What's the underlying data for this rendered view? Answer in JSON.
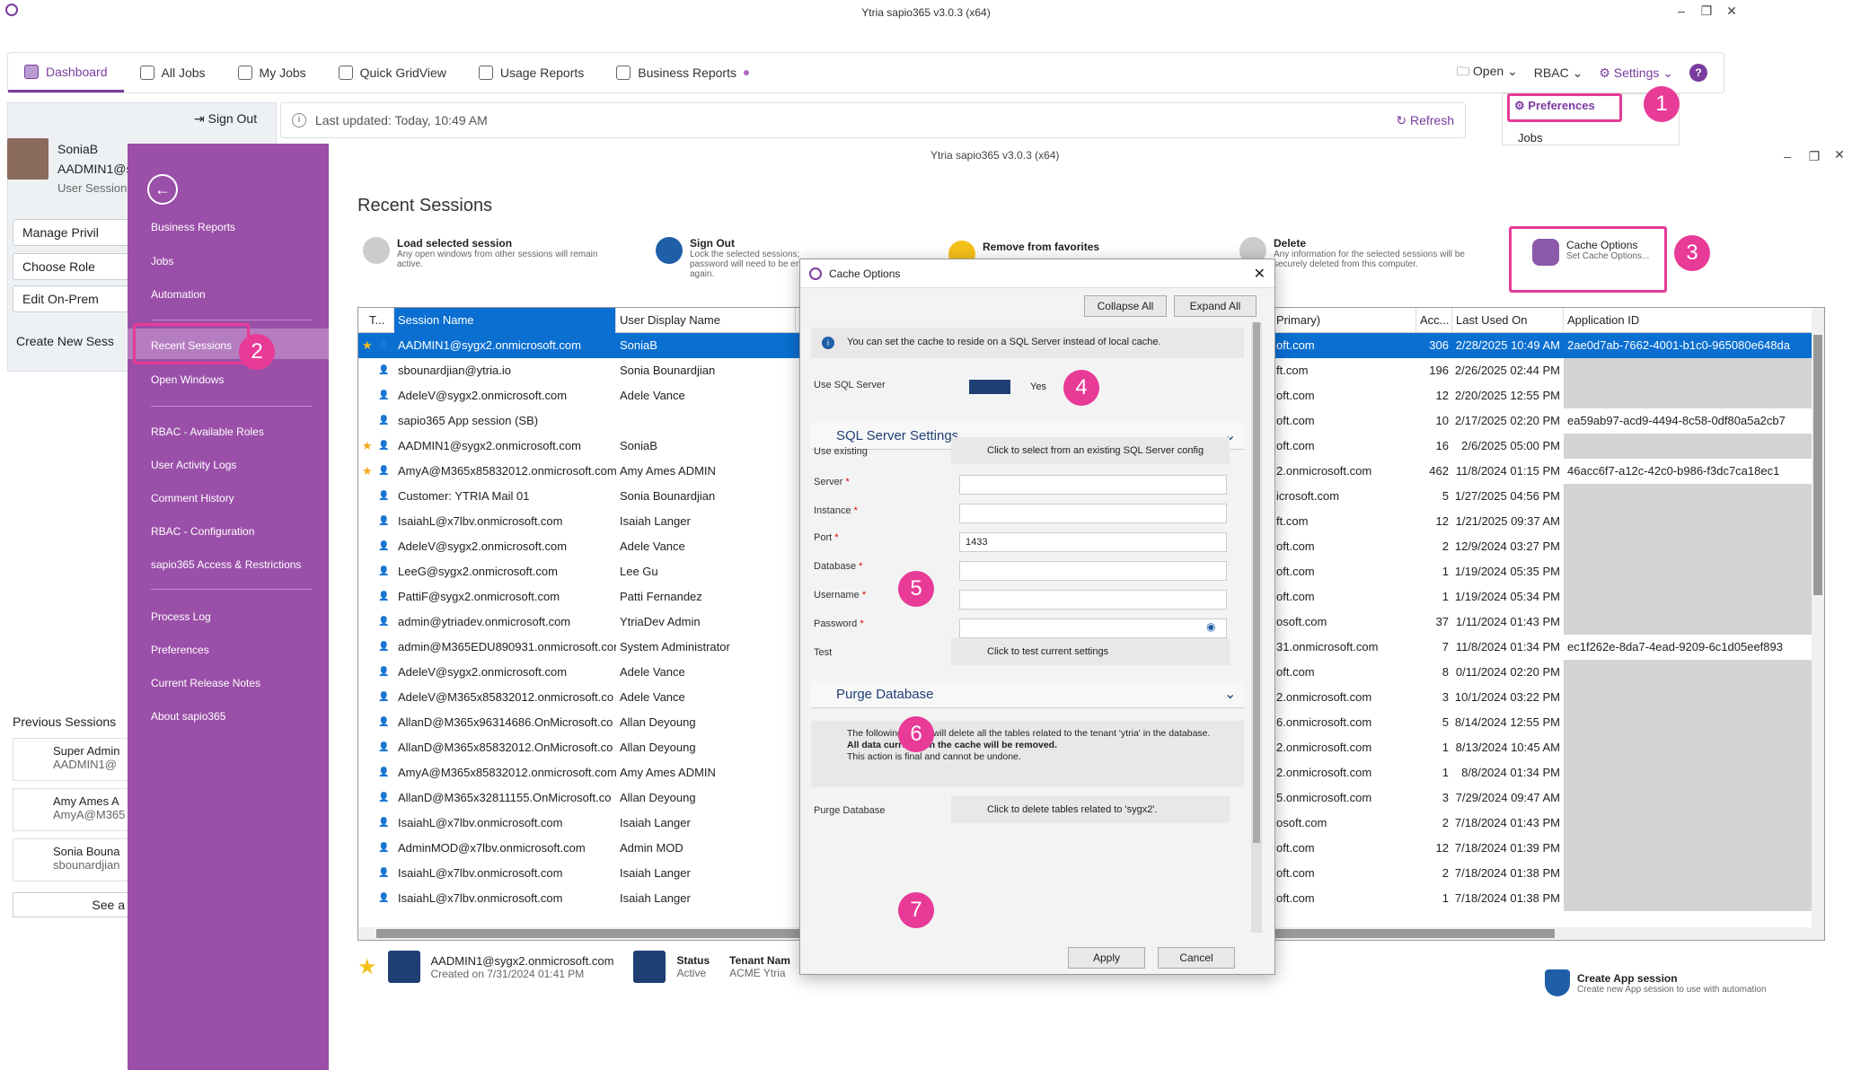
{
  "app": {
    "window_title": "Ytria sapio365 v3.0.3 (x64)",
    "inner_window_title": "Ytria sapio365 v3.0.3 (x64)"
  },
  "topnav": {
    "tabs": [
      {
        "label": "Dashboard"
      },
      {
        "label": "All Jobs"
      },
      {
        "label": "My Jobs"
      },
      {
        "label": "Quick GridView"
      },
      {
        "label": "Usage Reports"
      },
      {
        "label": "Business Reports"
      }
    ],
    "open": "Open",
    "rbac": "RBAC",
    "settings": "Settings",
    "help": "?"
  },
  "settings_menu": {
    "preferences": "Preferences",
    "jobs": "Jobs"
  },
  "left": {
    "sign_out": "Sign Out",
    "user_name": "SoniaB",
    "user_id": "AADMIN1@sy",
    "user_session": "User Session",
    "manage": "Manage Privil",
    "choose_role": "Choose Role",
    "edit_onprem": "Edit On-Prem",
    "create_new": "Create New Sess",
    "previous": "Previous Sessions",
    "prev_sessions": [
      {
        "name": "Super Admin",
        "sub": "AADMIN1@"
      },
      {
        "name": "Amy Ames A",
        "sub": "AmyA@M365"
      },
      {
        "name": "Sonia Bouna",
        "sub": "sbounardjian"
      }
    ],
    "see_all": "See a"
  },
  "infobar": {
    "last_updated": "Last updated: Today, 10:49 AM",
    "refresh": "Refresh"
  },
  "sidebar": {
    "items": [
      "Business Reports",
      "Jobs",
      "Automation",
      "Recent Sessions",
      "Open Windows",
      "RBAC - Available Roles",
      "User Activity Logs",
      "Comment History",
      "RBAC - Configuration",
      "sapio365 Access & Restrictions",
      "Process Log",
      "Preferences",
      "Current Release Notes",
      "About sapio365"
    ]
  },
  "content": {
    "title": "Recent Sessions",
    "actions": [
      {
        "title": "Load selected session",
        "desc": "Any open windows from other sessions will remain active."
      },
      {
        "title": "Sign Out",
        "desc": "Lock the selected sessions; password will need to be entered again."
      },
      {
        "title": "Remove from favorites",
        "desc": ""
      },
      {
        "title": "Delete",
        "desc": "Any information for the selected sessions will be securely deleted from this computer."
      },
      {
        "title": "Cache Options",
        "desc": "Set Cache Options..."
      }
    ]
  },
  "grid": {
    "headers": [
      "T...",
      "Session Name",
      "User Display Name",
      "Primary)",
      "Acc...",
      "Last Used On",
      "Application ID"
    ],
    "rows": [
      {
        "name": "AADMIN1@sygx2.onmicrosoft.com",
        "display": "SoniaB",
        "primary": "oft.com",
        "acc": "306",
        "last": "2/28/2025 10:49 AM",
        "app": "2ae0d7ab-7662-4001-b1c0-965080e648da",
        "star": true,
        "sel": true
      },
      {
        "name": "sbounardjian@ytria.io",
        "display": "Sonia Bounardjian",
        "primary": "ft.com",
        "acc": "196",
        "last": "2/26/2025 02:44 PM",
        "app": ""
      },
      {
        "name": "AdeleV@sygx2.onmicrosoft.com",
        "display": "Adele Vance",
        "primary": "oft.com",
        "acc": "12",
        "last": "2/20/2025 12:55 PM",
        "app": ""
      },
      {
        "name": "sapio365 App session (SB)",
        "display": "",
        "primary": "oft.com",
        "acc": "10",
        "last": "2/17/2025 02:20 PM",
        "app": "ea59ab97-acd9-4494-8c58-0df80a5a2cb7"
      },
      {
        "name": "AADMIN1@sygx2.onmicrosoft.com",
        "display": "SoniaB",
        "primary": "oft.com",
        "acc": "16",
        "last": "2/6/2025 05:00 PM",
        "app": "",
        "star": true
      },
      {
        "name": "AmyA@M365x85832012.onmicrosoft.com",
        "display": "Amy Ames ADMIN",
        "primary": "2.onmicrosoft.com",
        "acc": "462",
        "last": "11/8/2024 01:15 PM",
        "app": "46acc6f7-a12c-42c0-b986-f3dc7ca18ec1",
        "star": true
      },
      {
        "name": "Customer: YTRIA Mail 01",
        "display": "Sonia Bounardjian",
        "primary": "icrosoft.com",
        "acc": "5",
        "last": "1/27/2025 04:56 PM",
        "app": ""
      },
      {
        "name": "IsaiahL@x7lbv.onmicrosoft.com",
        "display": "Isaiah Langer",
        "primary": "ft.com",
        "acc": "12",
        "last": "1/21/2025 09:37 AM",
        "app": ""
      },
      {
        "name": "AdeleV@sygx2.onmicrosoft.com",
        "display": "Adele Vance",
        "primary": "oft.com",
        "acc": "2",
        "last": "12/9/2024 03:27 PM",
        "app": ""
      },
      {
        "name": "LeeG@sygx2.onmicrosoft.com",
        "display": "Lee Gu",
        "primary": "oft.com",
        "acc": "1",
        "last": "1/19/2024 05:35 PM",
        "app": ""
      },
      {
        "name": "PattiF@sygx2.onmicrosoft.com",
        "display": "Patti Fernandez",
        "primary": "oft.com",
        "acc": "1",
        "last": "1/19/2024 05:34 PM",
        "app": ""
      },
      {
        "name": "admin@ytriadev.onmicrosoft.com",
        "display": "YtriaDev Admin",
        "primary": "osoft.com",
        "acc": "37",
        "last": "1/11/2024 01:43 PM",
        "app": ""
      },
      {
        "name": "admin@M365EDU890931.onmicrosoft.cor",
        "display": "System Administrator",
        "primary": "31.onmicrosoft.com",
        "acc": "7",
        "last": "11/8/2024 01:34 PM",
        "app": "ec1f262e-8da7-4ead-9209-6c1d05eef893"
      },
      {
        "name": "AdeleV@sygx2.onmicrosoft.com",
        "display": "Adele Vance",
        "primary": "oft.com",
        "acc": "8",
        "last": "0/11/2024 02:20 PM",
        "app": ""
      },
      {
        "name": "AdeleV@M365x85832012.onmicrosoft.co",
        "display": "Adele Vance",
        "primary": "2.onmicrosoft.com",
        "acc": "3",
        "last": "10/1/2024 03:22 PM",
        "app": ""
      },
      {
        "name": "AllanD@M365x96314686.OnMicrosoft.co",
        "display": "Allan Deyoung",
        "primary": "6.onmicrosoft.com",
        "acc": "5",
        "last": "8/14/2024 12:55 PM",
        "app": ""
      },
      {
        "name": "AllanD@M365x85832012.OnMicrosoft.co",
        "display": "Allan Deyoung",
        "primary": "2.onmicrosoft.com",
        "acc": "1",
        "last": "8/13/2024 10:45 AM",
        "app": ""
      },
      {
        "name": "AmyA@M365x85832012.onmicrosoft.com",
        "display": "Amy Ames ADMIN",
        "primary": "2.onmicrosoft.com",
        "acc": "1",
        "last": "8/8/2024 01:34 PM",
        "app": ""
      },
      {
        "name": "AllanD@M365x32811155.OnMicrosoft.co",
        "display": "Allan Deyoung",
        "primary": "5.onmicrosoft.com",
        "acc": "3",
        "last": "7/29/2024 09:47 AM",
        "app": ""
      },
      {
        "name": "IsaiahL@x7lbv.onmicrosoft.com",
        "display": "Isaiah Langer",
        "primary": "osoft.com",
        "acc": "2",
        "last": "7/18/2024 01:43 PM",
        "app": ""
      },
      {
        "name": "AdminMOD@x7lbv.onmicrosoft.com",
        "display": "Admin MOD",
        "primary": "oft.com",
        "acc": "12",
        "last": "7/18/2024 01:39 PM",
        "app": ""
      },
      {
        "name": "IsaiahL@x7lbv.onmicrosoft.com",
        "display": "Isaiah Langer",
        "primary": "oft.com",
        "acc": "2",
        "last": "7/18/2024 01:38 PM",
        "app": ""
      },
      {
        "name": "IsaiahL@x7lbv.onmicrosoft.com",
        "display": "Isaiah Langer",
        "primary": "oft.com",
        "acc": "1",
        "last": "7/18/2024 01:38 PM",
        "app": ""
      }
    ]
  },
  "bottom": {
    "session": "AADMIN1@sygx2.onmicrosoft.com",
    "created": "Created on 7/31/2024 01:41 PM",
    "status_label": "Status",
    "status": "Active",
    "tenant_label": "Tenant Nam",
    "tenant": "ACME Ytria",
    "create_app": "Create App session",
    "create_app_desc": "Create new App session to use with automation"
  },
  "dialog": {
    "title": "Cache Options",
    "collapse": "Collapse All",
    "expand": "Expand All",
    "info": "You can set the cache to reside on a SQL Server instead of local cache.",
    "use_sql_label": "Use SQL Server",
    "use_sql_value": "Yes",
    "sql_section": "SQL Server Settings",
    "use_existing_label": "Use existing",
    "use_existing_btn": "Click to select from an existing SQL Server config",
    "server": "Server",
    "instance": "Instance",
    "port": "Port",
    "port_value": "1433",
    "database": "Database",
    "username": "Username",
    "password": "Password",
    "test_label": "Test",
    "test_btn": "Click to test current settings",
    "purge_section": "Purge Database",
    "purge_info1": "The following action will delete all the tables related to the tenant 'ytria' in the database.",
    "purge_info2": "All data currently in the cache will be removed.",
    "purge_info3": "This action is final and cannot be undone.",
    "purge_label": "Purge Database",
    "purge_btn": "Click to delete tables related to 'sygx2'.",
    "apply": "Apply",
    "cancel": "Cancel"
  },
  "badges": [
    "1",
    "2",
    "3",
    "4",
    "5",
    "6",
    "7"
  ],
  "colors": {
    "accent": "#7a3c9e",
    "sidebar": "#9a4fa8",
    "selection": "#0a6fd1",
    "callout": "#e83a97"
  }
}
